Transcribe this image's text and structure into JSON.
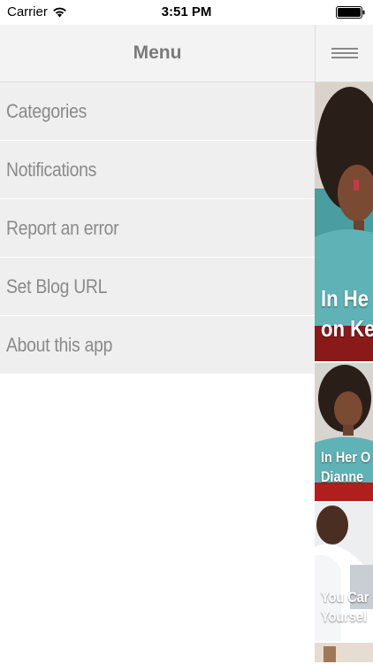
{
  "status_bar": {
    "carrier": "Carrier",
    "time": "3:51 PM"
  },
  "menu": {
    "title": "Menu",
    "items": [
      {
        "label": "Categories"
      },
      {
        "label": "Notifications"
      },
      {
        "label": "Report an error"
      },
      {
        "label": "Set Blog URL"
      },
      {
        "label": "About this app"
      }
    ]
  },
  "content": {
    "cards": [
      {
        "title_line1": "In He",
        "title_line2": "on Ke"
      },
      {
        "title_line1": "In Her O",
        "title_line2": "Dianne"
      },
      {
        "title_line1": "You Car",
        "title_line2": "Yoursel"
      }
    ]
  },
  "colors": {
    "menu_bg": "#efefef",
    "menu_text": "#8a8a8a",
    "header_bg": "#f3f3f3",
    "card_teal": "#3a8a8c"
  },
  "icons": {
    "wifi": "wifi-icon",
    "battery": "battery-icon",
    "menu_toggle": "hamburger-icon"
  }
}
